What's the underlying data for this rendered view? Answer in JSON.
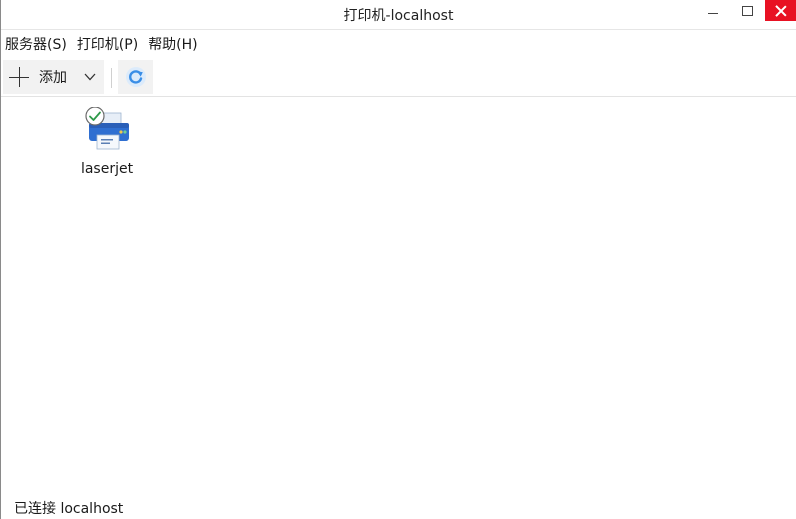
{
  "window": {
    "title": "打印机-localhost"
  },
  "menubar": {
    "items": [
      {
        "label": "服务器(S)"
      },
      {
        "label": "打印机(P)"
      },
      {
        "label": "帮助(H)"
      }
    ]
  },
  "toolbar": {
    "add_label": "添加",
    "add_icon": "plus-icon",
    "dropdown_icon": "chevron-down-icon",
    "refresh_icon": "refresh-icon"
  },
  "printers": [
    {
      "name": "laserjet",
      "status_icon": "check-icon",
      "default": true
    }
  ],
  "status": {
    "text": "已连接 localhost"
  },
  "colors": {
    "close_button": "#e81123",
    "printer_blue": "#2f6fd1",
    "refresh_blue": "#3a8ee6"
  }
}
